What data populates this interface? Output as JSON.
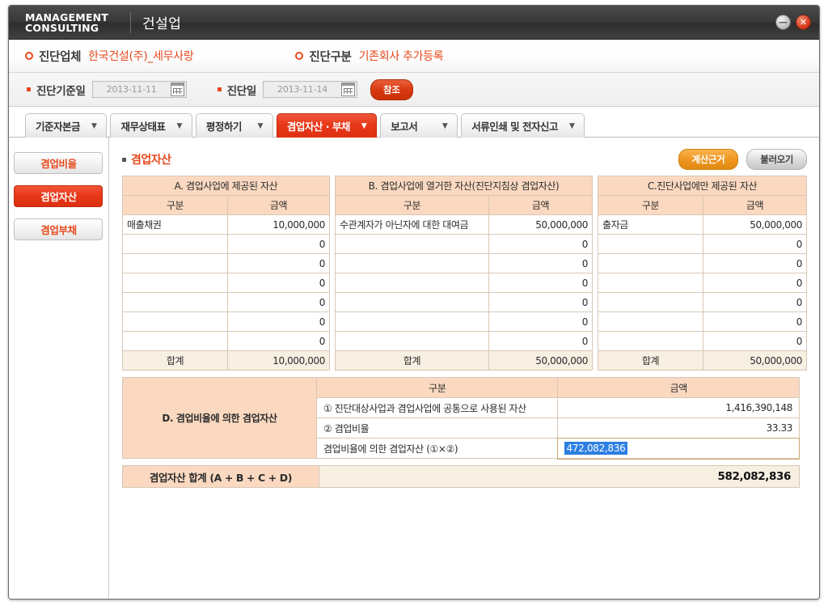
{
  "window": {
    "brand_line1": "MANAGEMENT",
    "brand_line2": "CONSULTING",
    "app_title": "건설업",
    "minimize_label": "—",
    "close_label": "✕"
  },
  "info": {
    "company_label": "진단업체",
    "company_value": "한국건설(주)_세무사랑",
    "type_label": "진단구분",
    "type_value": "기존회사  추가등록"
  },
  "dates": {
    "base_label": "진단기준일",
    "base_value": "2013-11-11",
    "diag_label": "진단일",
    "diag_value": "2013-11-14",
    "refresh_label": "참조"
  },
  "tabs": [
    {
      "label": "기준자본금",
      "caret": "▼",
      "active": false
    },
    {
      "label": "재무상태표",
      "caret": "▼",
      "active": false
    },
    {
      "label": "평정하기",
      "caret": "▼",
      "active": false
    },
    {
      "label": "겸업자산 · 부채",
      "caret": "▼",
      "active": true
    },
    {
      "label": "보고서",
      "caret": "▼",
      "active": false
    },
    {
      "label": "서류인쇄 및 전자신고",
      "caret": "▼",
      "active": false
    }
  ],
  "sidebar": {
    "items": [
      {
        "label": "겸업비율",
        "active": false
      },
      {
        "label": "겸업자산",
        "active": true
      },
      {
        "label": "겸업부채",
        "active": false
      }
    ]
  },
  "section": {
    "title": "겸업자산",
    "btn_calc": "계산근거",
    "btn_load": "불러오기"
  },
  "columns": {
    "gubun": "구분",
    "amount": "금액",
    "total": "합계"
  },
  "table_a": {
    "title": "A. 겸업사업에 제공된 자산",
    "rows": [
      {
        "name": "매출채권",
        "amount": "10,000,000"
      },
      {
        "name": "",
        "amount": "0"
      },
      {
        "name": "",
        "amount": "0"
      },
      {
        "name": "",
        "amount": "0"
      },
      {
        "name": "",
        "amount": "0"
      },
      {
        "name": "",
        "amount": "0"
      },
      {
        "name": "",
        "amount": "0"
      }
    ],
    "total": "10,000,000"
  },
  "table_b": {
    "title": "B. 겸업사업에 열거한 자산(진단지침상 겸업자산)",
    "rows": [
      {
        "name": "수관계자가 아닌자에 대한 대여금",
        "amount": "50,000,000"
      },
      {
        "name": "",
        "amount": "0"
      },
      {
        "name": "",
        "amount": "0"
      },
      {
        "name": "",
        "amount": "0"
      },
      {
        "name": "",
        "amount": "0"
      },
      {
        "name": "",
        "amount": "0"
      },
      {
        "name": "",
        "amount": "0"
      }
    ],
    "total": "50,000,000"
  },
  "table_c": {
    "title": "C.진단사업에만 제공된 자산",
    "rows": [
      {
        "name": "출자금",
        "amount": "50,000,000"
      },
      {
        "name": "",
        "amount": "0"
      },
      {
        "name": "",
        "amount": "0"
      },
      {
        "name": "",
        "amount": "0"
      },
      {
        "name": "",
        "amount": "0"
      },
      {
        "name": "",
        "amount": "0"
      },
      {
        "name": "",
        "amount": "0"
      }
    ],
    "total": "50,000,000"
  },
  "table_d": {
    "left_label": "D. 겸업비율에 의한 겸업자산",
    "head_gubun": "구분",
    "head_amount": "금액",
    "row1_label": "① 진단대상사업과 겸업사업에 공통으로 사용된 자산",
    "row1_value": "1,416,390,148",
    "row2_label": "② 겸업비율",
    "row2_value": "33.33",
    "row3_label": "겸업비율에 의한 겸업자산 (①×②)",
    "row3_value": "472,082,836"
  },
  "summary": {
    "label": "겸업자산 합계 (A + B + C + D)",
    "value": "582,082,836"
  },
  "colors": {
    "accent_orange": "#e8491d",
    "header_peach": "#fbd9c0",
    "total_beige": "#f7efe2",
    "selection_blue": "#2d7fe2"
  }
}
